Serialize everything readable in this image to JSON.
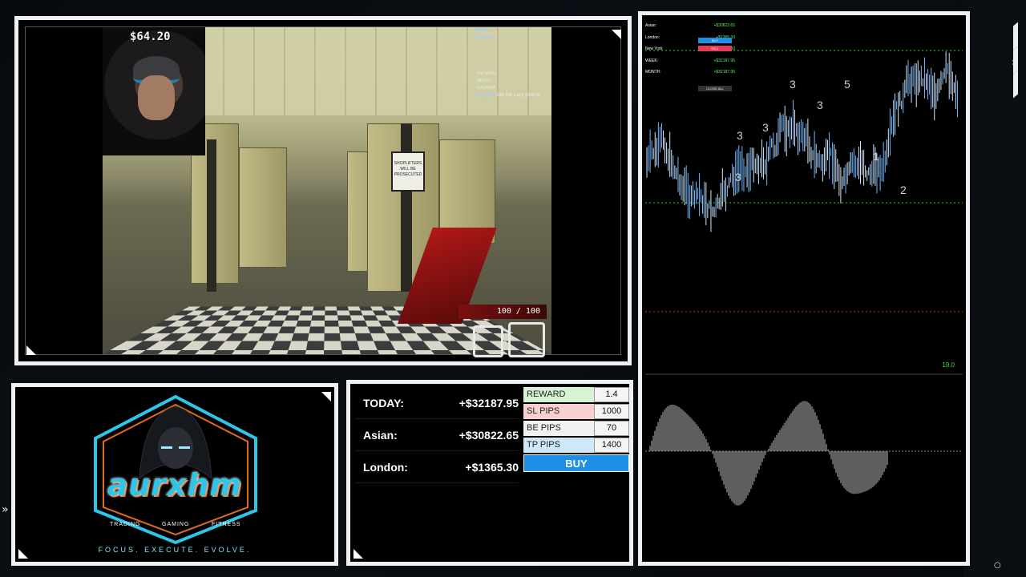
{
  "game": {
    "money": "$64.20",
    "health": "100 / 100",
    "chat": [
      {
        "name": "hpagie",
        "msg": ""
      },
      {
        "name": "zkfantasy",
        "msg": ""
      },
      {
        "name": "",
        "msg": ""
      },
      {
        "name": "",
        "msg": ""
      },
      {
        "name": "",
        "msg": ""
      },
      {
        "name": "",
        "msg": ""
      },
      {
        "name": "",
        "msg": "RETARD"
      },
      {
        "name": "",
        "msg": "WHAT"
      },
      {
        "name": "",
        "msg": "DISARM"
      },
      {
        "name": "andy_tk8",
        "msg": "Get the Lazy gnome"
      }
    ],
    "sign_text": "SHOPLIFTERS WILL BE PROSECUTED"
  },
  "logo": {
    "brand": "aurxhm",
    "categories": [
      "TRADING",
      "GAMING",
      "FITNESS"
    ],
    "tagline": "FOCUS. EXECUTE. EVOLVE."
  },
  "stats": {
    "rows": [
      {
        "label": "TODAY:",
        "value": "+$32187.95"
      },
      {
        "label": "Asian:",
        "value": "+$30822.65"
      },
      {
        "label": "London:",
        "value": "+$1365.30"
      }
    ],
    "trade": {
      "reward_label": "REWARD",
      "reward_value": "1.4",
      "sl_label": "SL PIPS",
      "sl_value": "1000",
      "be_label": "BE PIPS",
      "be_value": "70",
      "tp_label": "TP PIPS",
      "tp_value": "1400",
      "buy_label": "BUY"
    }
  },
  "chart": {
    "mini_rows": [
      {
        "label": "Asian:",
        "value": "+$30822.65"
      },
      {
        "label": "London:",
        "value": "+$1365.30"
      },
      {
        "label": "New York:",
        "value": "+$0.00"
      },
      {
        "label": "WEEK:",
        "value": "+$32187.95"
      },
      {
        "label": "MONTH:",
        "value": "+$32187.95"
      }
    ],
    "buttons": [
      "BUY",
      "SELL",
      "CLOSE ALL"
    ],
    "wave_labels": [
      "3",
      "3",
      "3",
      "3",
      "3",
      "5",
      "1",
      "2"
    ],
    "price_tag": "19.0",
    "colors": {
      "positive": "#29e629",
      "buy": "#1e8fe6",
      "sell": "#e23b5c"
    }
  }
}
